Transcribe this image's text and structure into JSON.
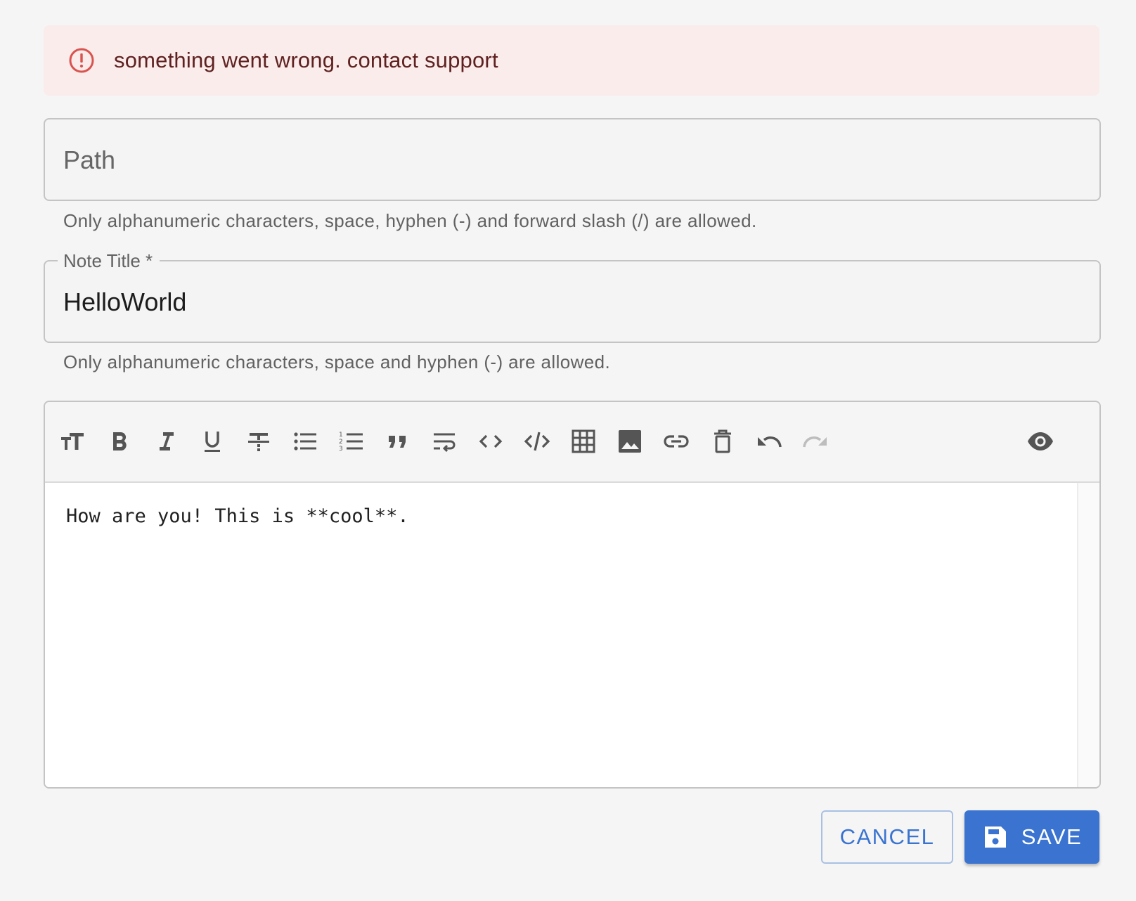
{
  "alert": {
    "icon": "error-outline-icon",
    "message": "something went wrong. contact support",
    "color": "#5f2120",
    "background": "#f9eceb",
    "icon_color": "#d9534f"
  },
  "path_field": {
    "placeholder": "Path",
    "value": "",
    "helper": "Only alphanumeric characters, space, hyphen (-) and forward slash (/) are allowed."
  },
  "title_field": {
    "label": "Note Title *",
    "value": "HelloWorld",
    "helper": "Only alphanumeric characters, space and hyphen (-) are allowed."
  },
  "editor": {
    "toolbar": [
      {
        "name": "heading-icon"
      },
      {
        "name": "bold-icon"
      },
      {
        "name": "italic-icon"
      },
      {
        "name": "underline-icon"
      },
      {
        "name": "strikethrough-icon"
      },
      {
        "name": "bulleted-list-icon"
      },
      {
        "name": "numbered-list-icon"
      },
      {
        "name": "quote-icon"
      },
      {
        "name": "line-break-icon"
      },
      {
        "name": "inline-code-icon"
      },
      {
        "name": "code-block-icon"
      },
      {
        "name": "table-icon"
      },
      {
        "name": "image-icon"
      },
      {
        "name": "link-icon"
      },
      {
        "name": "clear-icon"
      },
      {
        "name": "undo-icon"
      },
      {
        "name": "redo-icon",
        "disabled": true
      },
      {
        "name": "preview-eye-icon"
      }
    ],
    "content": "How are you! This is **cool**."
  },
  "actions": {
    "cancel_label": "CANCEL",
    "save_label": "SAVE",
    "accent": "#3a74d0"
  }
}
